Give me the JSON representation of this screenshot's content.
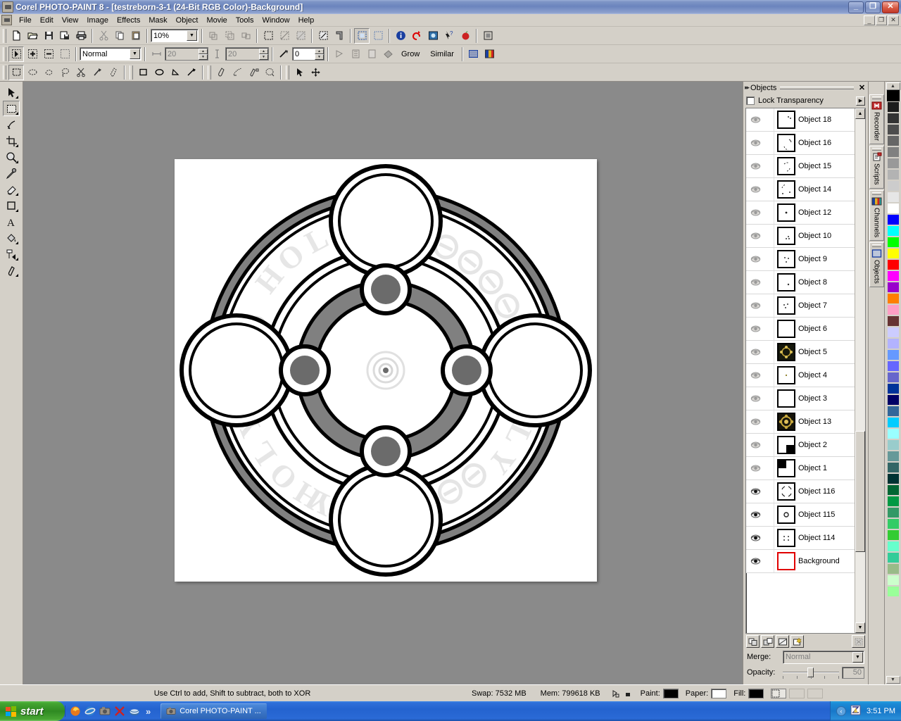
{
  "window": {
    "title": "Corel PHOTO-PAINT 8 - [testreborn-3-1  (24-Bit RGB Color)-Background]",
    "app_icon": "camera-icon",
    "minimize": "_",
    "maximize": "❐",
    "close": "✕",
    "mdi_minimize": "_",
    "mdi_restore": "❐",
    "mdi_close": "✕"
  },
  "menu": {
    "items": [
      "File",
      "Edit",
      "View",
      "Image",
      "Effects",
      "Mask",
      "Object",
      "Movie",
      "Tools",
      "Window",
      "Help"
    ]
  },
  "standard_toolbar": {
    "zoom_value": "10%",
    "buttons": [
      {
        "name": "new-icon"
      },
      {
        "name": "open-icon"
      },
      {
        "name": "save-icon"
      },
      {
        "name": "save-as-icon"
      },
      {
        "name": "print-icon"
      },
      {
        "name": "cut-icon"
      },
      {
        "name": "copy-icon"
      },
      {
        "name": "paste-icon"
      },
      {
        "name": "duplicate-icon"
      },
      {
        "name": "combine-icon"
      },
      {
        "name": "group-icon"
      },
      {
        "name": "mask-select-icon"
      },
      {
        "name": "mask-remove-icon"
      },
      {
        "name": "mask-invert-icon"
      },
      {
        "name": "mask-overlay-icon"
      },
      {
        "name": "mask-marquee-icon"
      },
      {
        "name": "object-marquee-icon"
      },
      {
        "name": "object-select-icon"
      },
      {
        "name": "info-icon"
      },
      {
        "name": "undo-list-icon"
      },
      {
        "name": "checkpoint-icon"
      },
      {
        "name": "whats-this-icon"
      },
      {
        "name": "corel-tutor-icon"
      },
      {
        "name": "full-screen-icon"
      }
    ]
  },
  "property_bar": {
    "mode_label": "Normal",
    "width_value": "20",
    "height_value": "20",
    "feather_value": "0",
    "grow_label": "Grow",
    "similar_label": "Similar"
  },
  "mask_toolbar": {
    "tools": [
      {
        "name": "rectangle-mask-icon"
      },
      {
        "name": "ellipse-mask-icon"
      },
      {
        "name": "freehand-mask-icon"
      },
      {
        "name": "lasso-mask-icon"
      },
      {
        "name": "scissors-mask-icon"
      },
      {
        "name": "magic-wand-mask-icon"
      },
      {
        "name": "mask-brush-icon"
      },
      {
        "name": "rectangle-shape-icon"
      },
      {
        "name": "ellipse-shape-icon"
      },
      {
        "name": "polygon-shape-icon"
      },
      {
        "name": "line-shape-icon"
      },
      {
        "name": "path-node-icon"
      },
      {
        "name": "path-edit-icon"
      },
      {
        "name": "path-convert-icon"
      },
      {
        "name": "path-mask-icon"
      },
      {
        "name": "pick-icon"
      },
      {
        "name": "pan-icon"
      }
    ]
  },
  "toolbox": {
    "tools": [
      {
        "name": "object-pick-tool",
        "glyph": "arrow",
        "selected": false
      },
      {
        "name": "mask-tool",
        "glyph": "marquee",
        "selected": true
      },
      {
        "name": "path-node-tool",
        "glyph": "node",
        "selected": false
      },
      {
        "name": "crop-tool",
        "glyph": "crop",
        "selected": false
      },
      {
        "name": "zoom-tool",
        "glyph": "magnifier",
        "selected": false
      },
      {
        "name": "eyedropper-tool",
        "glyph": "dropper",
        "selected": false
      },
      {
        "name": "eraser-tool",
        "glyph": "eraser",
        "selected": false
      },
      {
        "name": "rectangle-tool",
        "glyph": "rect",
        "selected": false
      },
      {
        "name": "text-tool",
        "glyph": "A",
        "selected": false
      },
      {
        "name": "fill-tool",
        "glyph": "bucket",
        "selected": false
      },
      {
        "name": "interactive-fill-tool",
        "glyph": "ifill",
        "selected": false
      },
      {
        "name": "clone-tool",
        "glyph": "clone",
        "selected": false
      }
    ]
  },
  "docker": {
    "title": "Objects",
    "close_label": "✕",
    "lock_transparency_label": "Lock Transparency",
    "lock_transparency_checked": false,
    "flyout_label": "▶",
    "objects": [
      {
        "name": "Object 18",
        "thumb": "dots-1",
        "visible": true,
        "selected": false
      },
      {
        "name": "Object 16",
        "thumb": "arc-1",
        "visible": true,
        "selected": false
      },
      {
        "name": "Object 15",
        "thumb": "arc-2",
        "visible": true,
        "selected": false
      },
      {
        "name": "Object 14",
        "thumb": "arc-3",
        "visible": true,
        "selected": false
      },
      {
        "name": "Object 12",
        "thumb": "dot-1",
        "visible": true,
        "selected": false
      },
      {
        "name": "Object 10",
        "thumb": "dots-2",
        "visible": true,
        "selected": false
      },
      {
        "name": "Object 9",
        "thumb": "dots-3",
        "visible": true,
        "selected": false
      },
      {
        "name": "Object 8",
        "thumb": "dot-2",
        "visible": true,
        "selected": false
      },
      {
        "name": "Object 7",
        "thumb": "dots-4",
        "visible": true,
        "selected": false
      },
      {
        "name": "Object 6",
        "thumb": "blank",
        "visible": true,
        "selected": false
      },
      {
        "name": "Object 5",
        "thumb": "gold-1",
        "visible": true,
        "selected": false
      },
      {
        "name": "Object 4",
        "thumb": "dot-3",
        "visible": true,
        "selected": false
      },
      {
        "name": "Object 3",
        "thumb": "blank",
        "visible": true,
        "selected": false
      },
      {
        "name": "Object 13",
        "thumb": "gold-2",
        "visible": true,
        "selected": false
      },
      {
        "name": "Object 2",
        "thumb": "corner-br",
        "visible": true,
        "selected": false
      },
      {
        "name": "Object 1",
        "thumb": "corner-tl",
        "visible": true,
        "selected": false
      },
      {
        "name": "Object 116",
        "thumb": "arcs-4",
        "visible": true,
        "selected": false
      },
      {
        "name": "Object 115",
        "thumb": "ring-1",
        "visible": true,
        "selected": false
      },
      {
        "name": "Object 114",
        "thumb": "dots-5",
        "visible": true,
        "selected": false
      },
      {
        "name": "Background",
        "thumb": "blank",
        "visible": true,
        "selected": true
      }
    ],
    "buttons": [
      {
        "name": "new-object-button"
      },
      {
        "name": "duplicate-object-button"
      },
      {
        "name": "object-to-mask-button"
      },
      {
        "name": "new-object-from-mask-button"
      },
      {
        "name": "delete-object-button"
      }
    ],
    "merge_label": "Merge:",
    "merge_value": "Normal",
    "opacity_label": "Opacity:",
    "opacity_value": "50"
  },
  "docker_tabs": [
    {
      "label": "Recorder",
      "icon": "recorder-icon",
      "active": false
    },
    {
      "label": "Scripts",
      "icon": "scripts-icon",
      "active": false
    },
    {
      "label": "Channels",
      "icon": "channels-icon",
      "active": false
    },
    {
      "label": "Objects",
      "icon": "objects-icon",
      "active": true
    }
  ],
  "palette": {
    "scroll_up": "▲",
    "scroll_down": "▼",
    "colors": [
      "#000000",
      "#1c1c1c",
      "#333333",
      "#4d4d4d",
      "#666666",
      "#808080",
      "#999999",
      "#b3b3b3",
      "#cccccc",
      "#e6e6e6",
      "#ffffff",
      "#0000ff",
      "#00ffff",
      "#00ff00",
      "#ffff00",
      "#ff0000",
      "#ff00ff",
      "#9900cc",
      "#ff7f00",
      "#ff9ec4",
      "#663333",
      "#ccccff",
      "#b3b3ff",
      "#6699ff",
      "#6666ff",
      "#6666cc",
      "#003399",
      "#000066",
      "#336699",
      "#00ccff",
      "#99ffff",
      "#99cccc",
      "#669999",
      "#336666",
      "#003333",
      "#006633",
      "#009944",
      "#339966",
      "#33cc66",
      "#33cc33",
      "#66ffcc",
      "#33cc99",
      "#99bb88",
      "#ccffcc",
      "#99ff99"
    ]
  },
  "statusbar": {
    "hint": "Use Ctrl to add, Shift to subtract, both to XOR",
    "swap": "Swap: 7532 MB",
    "memory": "Mem: 799618 KB",
    "paint_label": "Paint:",
    "paint_color": "#000000",
    "paper_label": "Paper:",
    "paper_color": "#ffffff",
    "fill_label": "Fill:",
    "fill_color": "#000000"
  },
  "taskbar": {
    "start_label": "start",
    "quick_launch": [
      {
        "name": "firefox-icon",
        "color": "#e8791e"
      },
      {
        "name": "ie-icon",
        "color": "#2f7fd0"
      },
      {
        "name": "corel-icon",
        "color": "#8b8b8b"
      },
      {
        "name": "xnview-icon",
        "color": "#cc2222"
      },
      {
        "name": "mail-icon",
        "color": "#3b6ea5"
      }
    ],
    "more_label": "»",
    "task_label": "Corel PHOTO-PAINT ...",
    "tray_hide_label": "‹",
    "tray_icon": "zonealarm-icon",
    "clock": "3:51 PM"
  },
  "artwork": {
    "watermark_text": "HOLY",
    "canvas_bg": "#ffffff",
    "line_color": "#000000",
    "accent_gray": "#808080",
    "dark_gray": "#666666"
  }
}
